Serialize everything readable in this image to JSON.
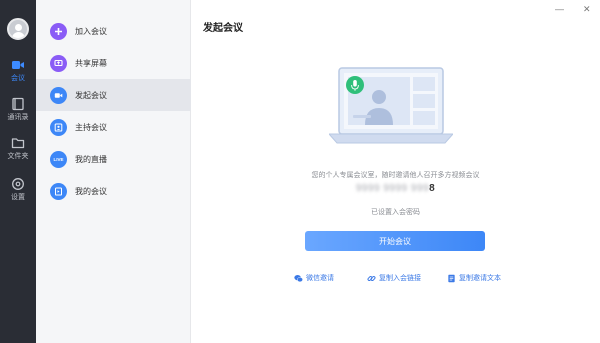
{
  "rail": {
    "items": [
      {
        "icon": "video-camera-icon",
        "label": "会议"
      },
      {
        "icon": "contacts-icon",
        "label": "通讯录"
      },
      {
        "icon": "folder-icon",
        "label": "文件夹"
      },
      {
        "icon": "settings-icon",
        "label": "设置"
      }
    ],
    "active_color": "#3d8bff"
  },
  "menu": {
    "items": [
      {
        "label": "加入会议",
        "icon": "plus-icon",
        "color": "#8a5cf6"
      },
      {
        "label": "共享屏幕",
        "icon": "share-screen-icon",
        "color": "#8a5cf6"
      },
      {
        "label": "发起会议",
        "icon": "video-camera-icon",
        "color": "#3d87f7"
      },
      {
        "label": "主持会议",
        "icon": "host-icon",
        "color": "#3d87f7"
      },
      {
        "label": "我的直播",
        "icon": "live-icon",
        "color": "#3d87f7",
        "badge": "LIVE"
      },
      {
        "label": "我的会议",
        "icon": "my-meeting-icon",
        "color": "#3d87f7"
      }
    ],
    "active_index": 2
  },
  "main": {
    "title": "发起会议",
    "description": "您的个人专属会议室，随时邀请他人召开多方视频会议",
    "room_number_suffix": "8",
    "room_number_blurred": "9999 9999 999",
    "password_status": "已设置入会密码",
    "start_button": "开始会议",
    "links": [
      {
        "icon": "wechat-icon",
        "label": "微信邀请"
      },
      {
        "icon": "link-icon",
        "label": "复制入会链接"
      },
      {
        "icon": "document-icon",
        "label": "复制邀请文本"
      }
    ]
  },
  "window_controls": {
    "minimize": "—",
    "close": "✕"
  }
}
